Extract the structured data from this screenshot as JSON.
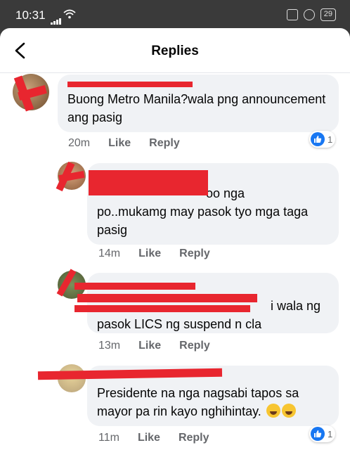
{
  "status": {
    "time": "10:31",
    "battery": "29"
  },
  "header": {
    "title": "Replies"
  },
  "comments": [
    {
      "text": "Buong Metro Manila?wala png announcement ang pasig",
      "time": "20m",
      "like": "Like",
      "reply": "Reply",
      "reactions": "1"
    },
    {
      "text_visible": "oo nga",
      "text": "po..mukamg may pasok tyo mga taga pasig",
      "time": "14m",
      "like": "Like",
      "reply": "Reply"
    },
    {
      "text_visible": "i wala ng",
      "text": "pasok LICS ng suspend n cla",
      "time": "13m",
      "like": "Like",
      "reply": "Reply"
    },
    {
      "text_line1": "Presidente na nga nagsabi tapos sa",
      "text_line2": "mayor pa rin kayo nghihintay.",
      "time": "11m",
      "like": "Like",
      "reply": "Reply",
      "reactions": "1"
    }
  ],
  "colors": {
    "like_blue": "#1877f2",
    "redact_red": "#e8262f",
    "bubble": "#f0f2f5"
  }
}
